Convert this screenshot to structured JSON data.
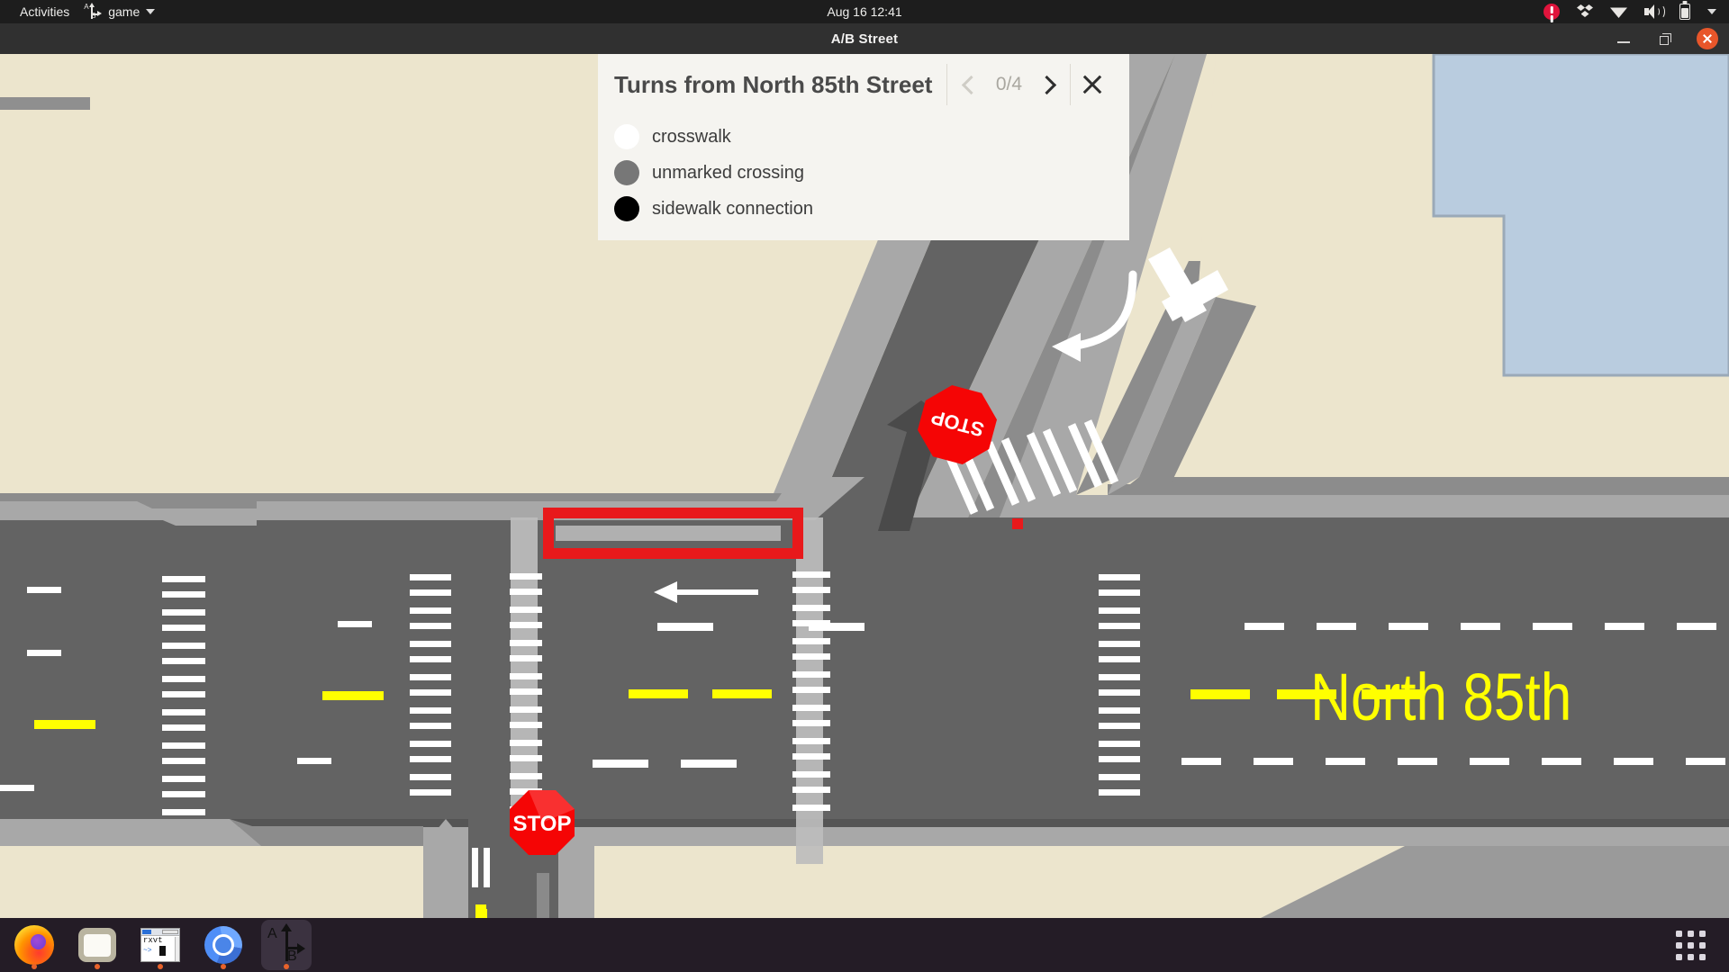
{
  "system_bar": {
    "activities": "Activities",
    "app_name": "game",
    "app_icon": "ab-street-icon",
    "clock": "Aug 16  12:41",
    "tray": [
      {
        "name": "alert-icon"
      },
      {
        "name": "dropbox-icon"
      },
      {
        "name": "wifi-icon"
      },
      {
        "name": "volume-icon"
      },
      {
        "name": "battery-icon"
      },
      {
        "name": "chevron-down-icon"
      }
    ]
  },
  "window": {
    "title": "A/B Street",
    "controls": [
      {
        "name": "minimize-button"
      },
      {
        "name": "maximize-button"
      },
      {
        "name": "close-button"
      }
    ]
  },
  "info_panel": {
    "title": "Turns from North 85th Street",
    "counter": "0/4",
    "prev_label": "previous",
    "next_label": "next",
    "close_label": "close",
    "legend": [
      {
        "label": "crosswalk",
        "color": "#ffffff"
      },
      {
        "label": "unmarked crossing",
        "color": "#777777"
      },
      {
        "label": "sidewalk connection",
        "color": "#000000"
      }
    ]
  },
  "map": {
    "street_label": "North 85th",
    "street_label_color": "#ffff00",
    "stop_sign_text": "STOP",
    "stop_sign_color": "#f50505",
    "selection_color": "#e8191b",
    "colors": {
      "road": "#636363",
      "road_dark": "#5a5a5a",
      "sidewalk": "#a8a8a8",
      "sidewalk_edge": "#8c8c8c",
      "grass": "#ece5cd",
      "water": "#b9ccdf",
      "lane_white": "#ffffff",
      "lane_yellow": "#ffff00"
    },
    "stop_signs": [
      {
        "name": "stop-sign-ne",
        "text": "STOP"
      },
      {
        "name": "stop-sign-s",
        "text": "STOP"
      }
    ]
  },
  "taskbar": {
    "items": [
      {
        "name": "taskbar-item-firefox",
        "icon": "firefox-icon",
        "running": true
      },
      {
        "name": "taskbar-item-files",
        "icon": "files-icon",
        "running": true
      },
      {
        "name": "taskbar-item-terminal",
        "icon": "rxvt-terminal-icon",
        "running": true,
        "text": "rxvt",
        "prompt": "~>"
      },
      {
        "name": "taskbar-item-chromium",
        "icon": "chromium-icon",
        "running": true
      },
      {
        "name": "taskbar-item-abstreet",
        "icon": "ab-street-icon",
        "running": true,
        "active": true
      }
    ],
    "app_grid": "show-applications"
  }
}
